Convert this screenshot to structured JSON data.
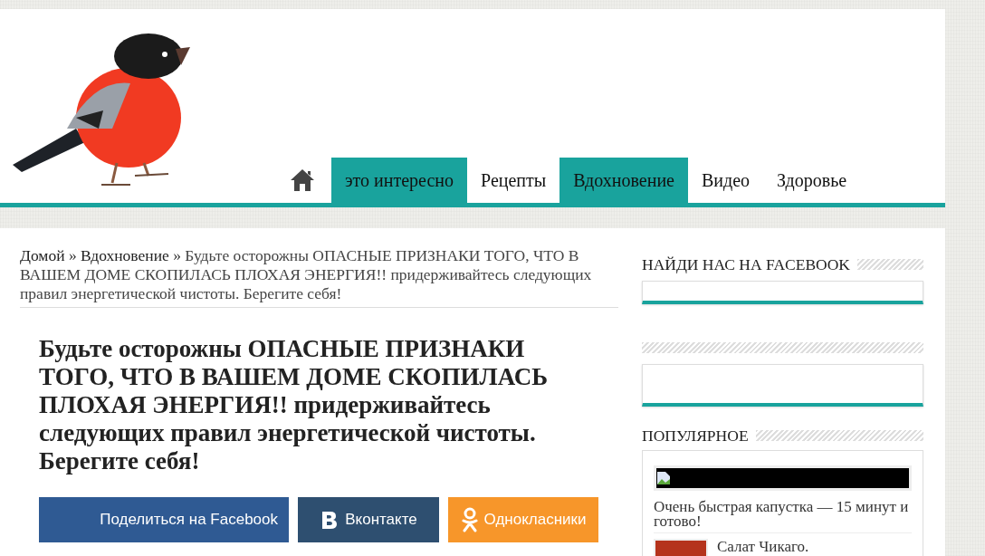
{
  "nav": {
    "items": [
      {
        "label": "это интересно",
        "selected": true
      },
      {
        "label": "Рецепты",
        "selected": false
      },
      {
        "label": "Вдохновение",
        "selected": true
      },
      {
        "label": "Видео",
        "selected": false
      },
      {
        "label": "Здоровье",
        "selected": false
      }
    ]
  },
  "breadcrumb": {
    "separator": "»",
    "items": [
      {
        "kind": "link",
        "label": "Домой"
      },
      {
        "kind": "link",
        "label": "Вдохновение"
      },
      {
        "kind": "current",
        "label": "Будьте осторожны ОПАСНЫЕ ПРИЗНАКИ ТОГО, ЧТО В ВАШЕМ ДОМЕ СКОПИЛАСЬ ПЛОХАЯ ЭНЕРГИЯ!! придерживайтесь следующих правил энергетической чистоты. Берегите себя!"
      }
    ]
  },
  "article": {
    "title": "Будьте осторожны ОПАСНЫЕ ПРИЗНАКИ ТОГО, ЧТО В ВАШЕМ ДОМЕ СКОПИЛАСЬ ПЛОХАЯ ЭНЕРГИЯ!! придерживайтесь следующих правил энергетической чистоты. Берегите себя!",
    "share_buttons": [
      {
        "kind": "facebook",
        "label": "Поделиться на Facebook"
      },
      {
        "kind": "vk",
        "label": "Вконтакте"
      },
      {
        "kind": "ok",
        "label": "Однокласники"
      }
    ]
  },
  "sidebar": {
    "widgets": [
      {
        "kind": "box",
        "title": "НАЙДИ НАС НА FACEBOOK"
      },
      {
        "kind": "box_tall"
      },
      {
        "kind": "popular",
        "title": "ПОПУЛЯРНОЕ",
        "posts": [
          {
            "kind": "banner",
            "title": "Очень быстрая капустка — 15 минут и готово!"
          },
          {
            "kind": "thumb",
            "title": "Салат Чикаго."
          }
        ]
      }
    ]
  }
}
